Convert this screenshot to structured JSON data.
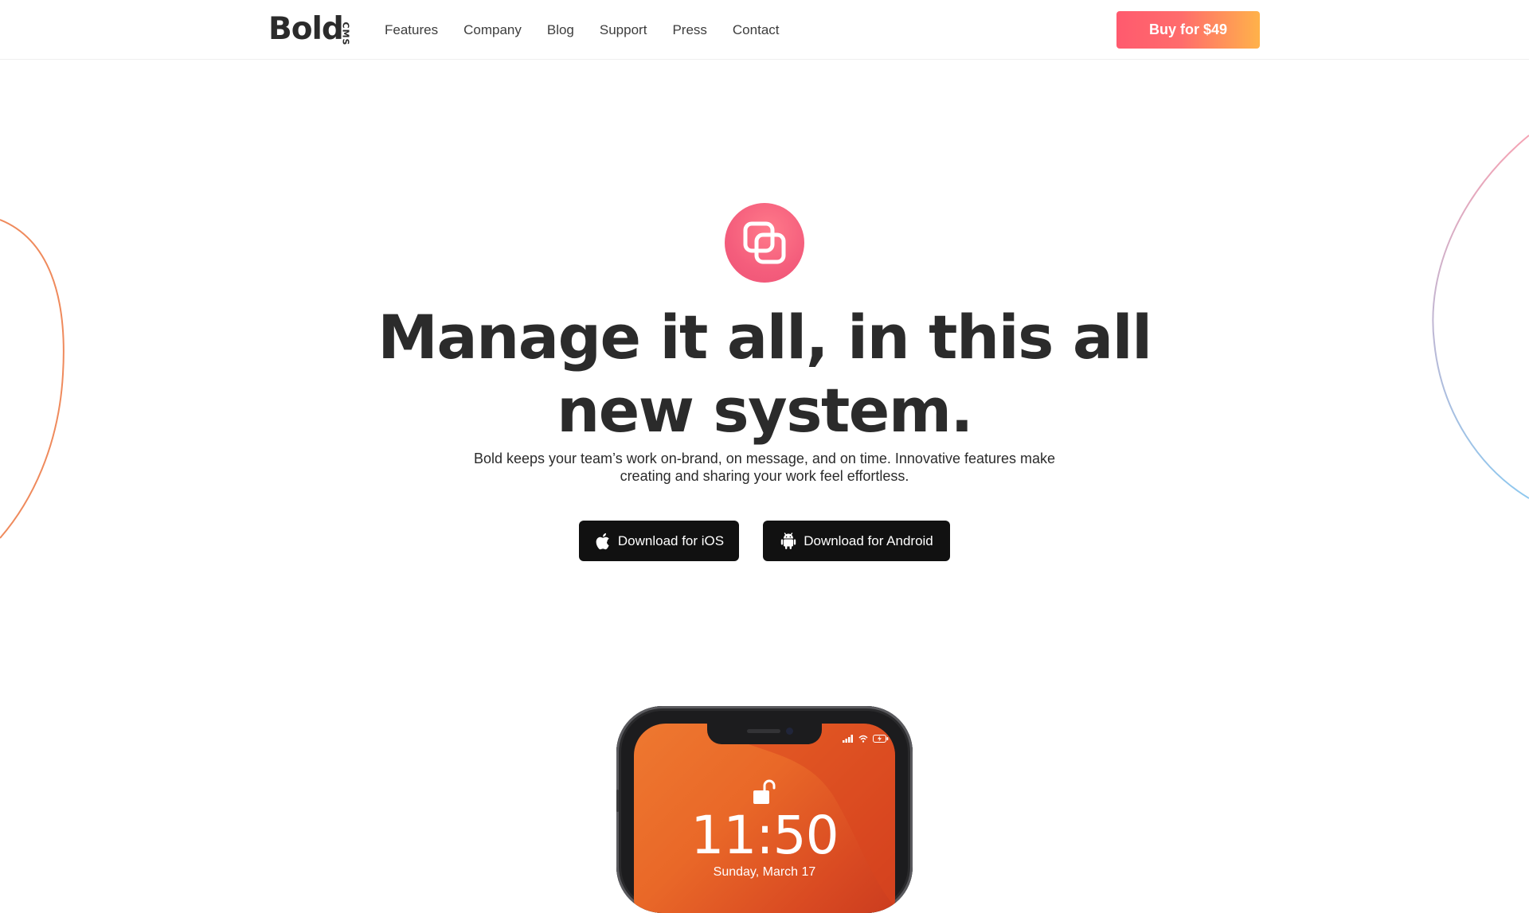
{
  "header": {
    "logo_text": "Bold",
    "logo_badge": "CMS",
    "nav": [
      "Features",
      "Company",
      "Blog",
      "Support",
      "Press",
      "Contact"
    ],
    "buy_label": "Buy for $49"
  },
  "hero": {
    "icon": "overlapping-squares-icon",
    "title": "Manage it all, in this all new system.",
    "subtitle": "Bold keeps your team’s work on-brand, on message, and on time. Innovative features make creating and sharing your work feel effortless.",
    "ios_label": "Download for iOS",
    "ios_icon": "apple-icon",
    "android_label": "Download for Android",
    "android_icon": "android-icon"
  },
  "phone": {
    "time": "11:50",
    "date": "Sunday, March 17",
    "lock_icon": "unlocked-padlock-icon",
    "status_icons": [
      "signal-icon",
      "wifi-icon",
      "battery-charging-icon"
    ]
  },
  "colors": {
    "buy_gradient_start": "#ff5a6e",
    "buy_gradient_end": "#ffb24a",
    "hero_icon": "#f45d7c",
    "download_button": "#111111",
    "left_arc": "#ef8a5c",
    "right_arc_top": "#f5a3b4",
    "right_arc_bottom": "#8ec8ef",
    "phone_screen": "#e96828"
  }
}
